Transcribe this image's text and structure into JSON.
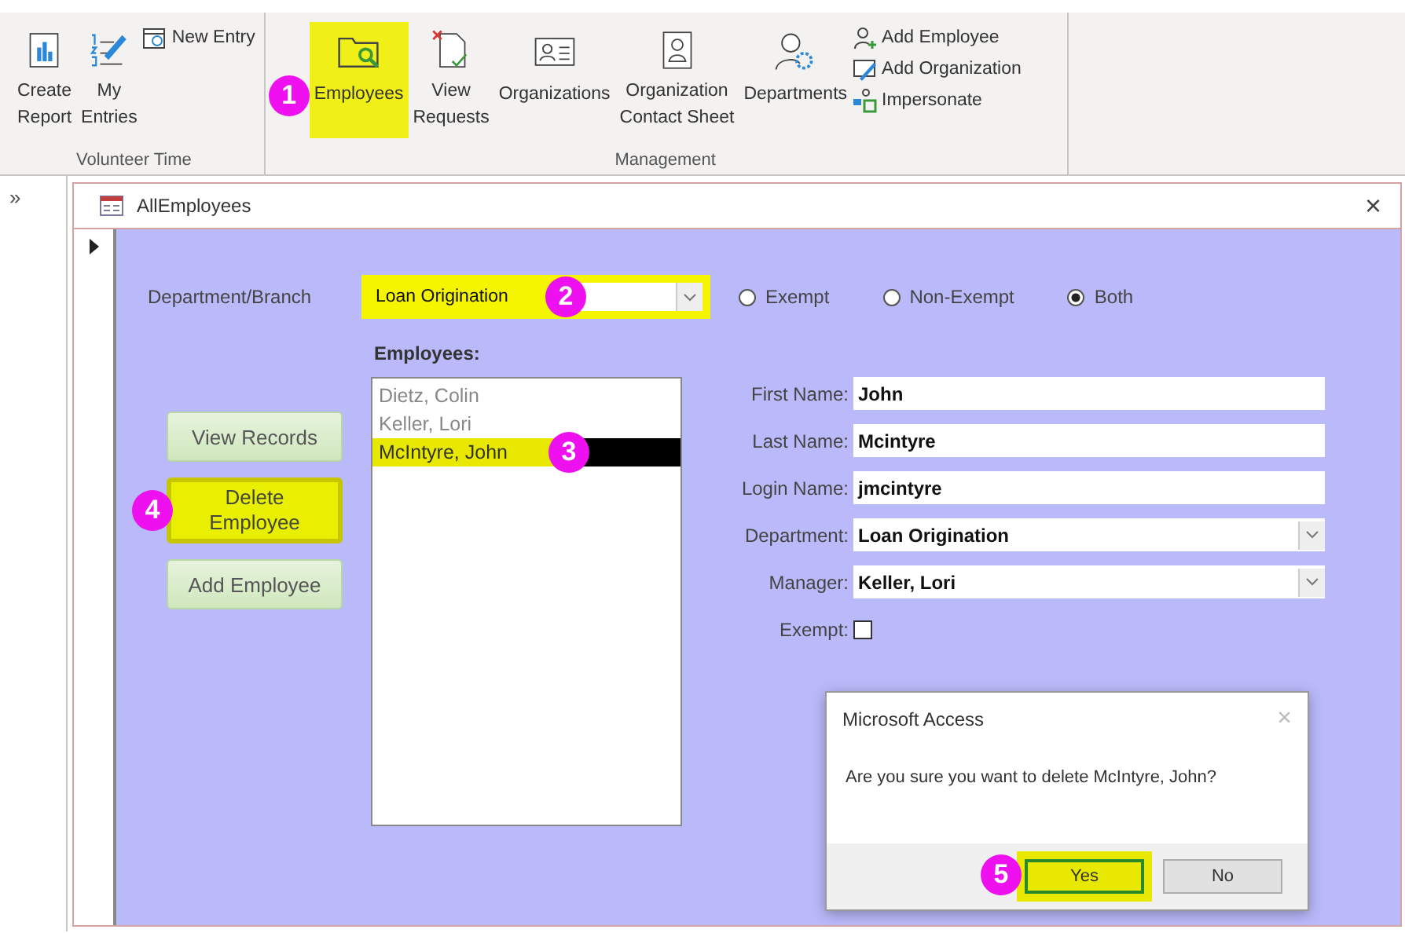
{
  "ribbon": {
    "groups": [
      {
        "label": "Volunteer Time",
        "large": [
          {
            "label": "Create\nReport",
            "kind": "report",
            "highlighted": false
          },
          {
            "label": "My\nEntries",
            "kind": "entries",
            "highlighted": false
          }
        ],
        "small": [
          {
            "label": "New Entry",
            "kind": "calendar"
          }
        ]
      },
      {
        "label": "Management",
        "large": [
          {
            "label": "Employees",
            "kind": "folder",
            "highlighted": true,
            "callout": "1"
          },
          {
            "label": "View\nRequests",
            "kind": "document",
            "highlighted": false
          },
          {
            "label": "Organizations",
            "kind": "card",
            "highlighted": false
          },
          {
            "label": "Organization\nContact Sheet",
            "kind": "contact",
            "highlighted": false
          },
          {
            "label": "Departments",
            "kind": "people",
            "highlighted": false
          }
        ],
        "small": [
          {
            "label": "Add Employee",
            "kind": "person-add"
          },
          {
            "label": "Add Organization",
            "kind": "org-edit"
          },
          {
            "label": "Impersonate",
            "kind": "swap"
          }
        ]
      }
    ]
  },
  "nav_pane": {
    "toggle": "»"
  },
  "form": {
    "title": "AllEmployees",
    "close": "×",
    "department_filter": {
      "label": "Department/Branch",
      "value": "Loan Origination",
      "highlighted": true,
      "callout": "2"
    },
    "exempt_filter": [
      {
        "label": "Exempt",
        "selected": false
      },
      {
        "label": "Non-Exempt",
        "selected": false
      },
      {
        "label": "Both",
        "selected": true
      }
    ],
    "buttons": [
      {
        "label": "View Records",
        "highlighted": false
      },
      {
        "label": "Delete Employee",
        "highlighted": true,
        "callout": "4"
      },
      {
        "label": "Add Employee",
        "highlighted": false
      }
    ],
    "employees": {
      "label": "Employees:",
      "items": [
        {
          "name": "Dietz, Colin",
          "selected": false,
          "highlighted": false
        },
        {
          "name": "Keller, Lori",
          "selected": false,
          "highlighted": false
        },
        {
          "name": "McIntyre, John",
          "selected": true,
          "highlighted": true,
          "callout": "3"
        }
      ]
    },
    "fields": [
      {
        "label": "First Name:",
        "value": "John",
        "kind": "text"
      },
      {
        "label": "Last Name:",
        "value": "Mcintyre",
        "kind": "text"
      },
      {
        "label": "Login Name:",
        "value": "jmcintyre",
        "kind": "text"
      },
      {
        "label": "Department:",
        "value": "Loan Origination",
        "kind": "combo"
      },
      {
        "label": "Manager:",
        "value": "Keller, Lori",
        "kind": "combo"
      },
      {
        "label": "Exempt:",
        "checked": false,
        "kind": "checkbox"
      }
    ]
  },
  "dialog": {
    "title": "Microsoft Access",
    "close": "×",
    "message": "Are you sure you want to delete McIntyre, John?",
    "buttons": [
      {
        "label": "Yes",
        "default": true,
        "highlighted": true,
        "callout": "5"
      },
      {
        "label": "No",
        "default": false,
        "highlighted": false
      }
    ]
  }
}
